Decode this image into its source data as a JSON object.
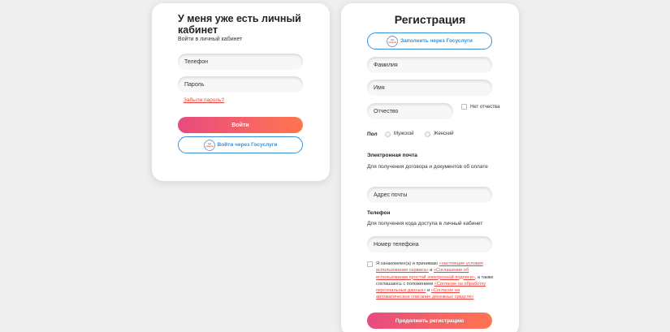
{
  "login": {
    "title": "У меня уже есть личный кабинет",
    "subtitle": "Войти в личный кабинет",
    "phone_placeholder": "Телефон",
    "password_placeholder": "Пароль",
    "forgot_link": "Забыли пароль?",
    "submit_label": "Войти",
    "gosuslugi_label": "Войти через Госуслуги"
  },
  "register": {
    "title": "Регистрация",
    "gosuslugi_label": "Заполнить через Госуслуги",
    "lastname_placeholder": "Фамилия",
    "firstname_placeholder": "Имя",
    "middlename_placeholder": "Отчество",
    "no_middlename_label": "Нет отчества",
    "gender_label": "Пол",
    "gender_male": "Мужской",
    "gender_female": "Женский",
    "email_heading": "Электронная почта",
    "email_hint": "Для получения договора и документов об оплате",
    "email_placeholder": "Адрес почты",
    "phone_heading": "Телефон",
    "phone_hint": "Для получения кода доступа в личный кабинет",
    "phone_placeholder": "Номер телефона",
    "consent": {
      "t1": "Я ознакомлен(а) и принимаю ",
      "l1": "«настоящие условия использования сервиса»",
      "t2": " и ",
      "l2": "«Соглашение об использовании простой электронной подписи»",
      "t3": ", а также соглашаюсь с положением ",
      "l3": "«Согласие на обработку персональных данных»",
      "t4": " и ",
      "l4": "«Согласие на автоматическое списание денежных средств»"
    },
    "submit_label": "Продолжить регистрацию"
  },
  "gosuslugi_logo": {
    "text": "гос\nуслуги",
    "color_blue": "#2b5fa8",
    "color_red": "#e23b3b"
  },
  "colors": {
    "accent_start": "#e84a7f",
    "accent_end": "#ff7650",
    "link_red": "#e8423a",
    "gos_blue": "#3a8fd6"
  }
}
